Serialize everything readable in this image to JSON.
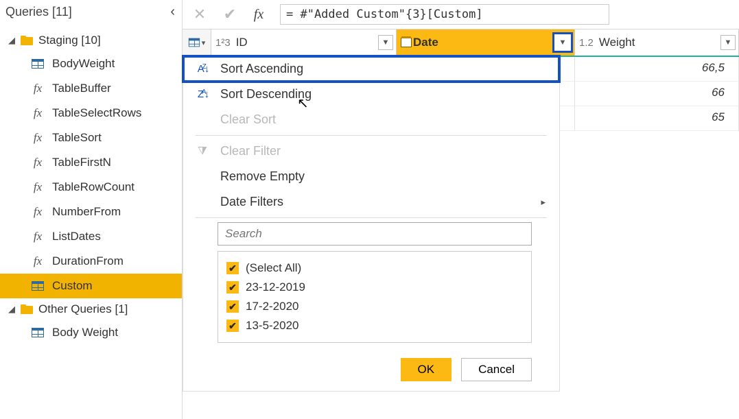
{
  "sidebar": {
    "title": "Queries [11]",
    "groups": [
      {
        "label": "Staging [10]",
        "items": [
          {
            "label": "BodyWeight",
            "kind": "table",
            "selected": false
          },
          {
            "label": "TableBuffer",
            "kind": "fx",
            "selected": false
          },
          {
            "label": "TableSelectRows",
            "kind": "fx",
            "selected": false
          },
          {
            "label": "TableSort",
            "kind": "fx",
            "selected": false
          },
          {
            "label": "TableFirstN",
            "kind": "fx",
            "selected": false
          },
          {
            "label": "TableRowCount",
            "kind": "fx",
            "selected": false
          },
          {
            "label": "NumberFrom",
            "kind": "fx",
            "selected": false
          },
          {
            "label": "ListDates",
            "kind": "fx",
            "selected": false
          },
          {
            "label": "DurationFrom",
            "kind": "fx",
            "selected": false
          },
          {
            "label": "Custom",
            "kind": "table",
            "selected": true
          }
        ]
      },
      {
        "label": "Other Queries [1]",
        "items": [
          {
            "label": "Body Weight",
            "kind": "table",
            "selected": false
          }
        ]
      }
    ]
  },
  "formula_bar": {
    "value": "= #\"Added Custom\"{3}[Custom]"
  },
  "grid": {
    "columns": {
      "id_type": "1²3",
      "id_label": "ID",
      "date_label": "Date",
      "weight_type": "1.2",
      "weight_label": "Weight"
    },
    "rows": [
      {
        "weight": "66,5"
      },
      {
        "weight": "66"
      },
      {
        "weight": "65"
      }
    ]
  },
  "context_menu": {
    "sort_asc": "Sort Ascending",
    "sort_desc": "Sort Descending",
    "clear_sort": "Clear Sort",
    "clear_filter": "Clear Filter",
    "remove_empty": "Remove Empty",
    "date_filters": "Date Filters",
    "search_placeholder": "Search",
    "options": [
      {
        "label": "(Select All)",
        "checked": true
      },
      {
        "label": "23-12-2019",
        "checked": true
      },
      {
        "label": "17-2-2020",
        "checked": true
      },
      {
        "label": "13-5-2020",
        "checked": true
      }
    ],
    "ok": "OK",
    "cancel": "Cancel"
  }
}
